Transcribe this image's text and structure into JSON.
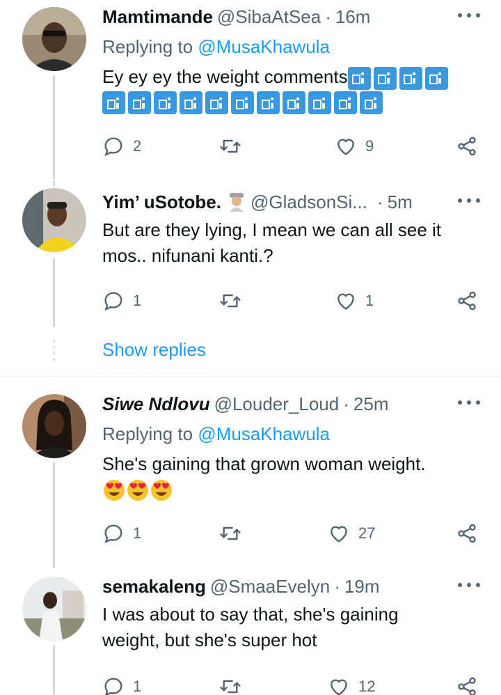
{
  "tweets": [
    {
      "name": "Mamtimande",
      "handle": "@SibaAtSea",
      "time": "16m",
      "replying_label": "Replying to",
      "replying_to": "@MusaKhawula",
      "text": "Ey ey ey the weight comments",
      "emoji_name": "wastebasket-emoji",
      "emoji_count_line1": 4,
      "emoji_count_line2": 11,
      "replies": "2",
      "retweets": "",
      "likes": "9"
    },
    {
      "name": "Yim’ uSotobe.",
      "handle": "@GladsonSi...",
      "time": "5m",
      "text": "But are they lying, I mean we can all see it mos.. nifunani kanti.?",
      "replies": "1",
      "retweets": "",
      "likes": "1"
    },
    {
      "name": "Siwe Ndlovu",
      "handle": "@Louder_Loud",
      "time": "25m",
      "replying_label": "Replying to",
      "replying_to": "@MusaKhawula",
      "text": "She's gaining that grown woman weight.",
      "emoji_name": "heart-eyes-emoji",
      "emoji_count": 3,
      "replies": "1",
      "retweets": "",
      "likes": "27"
    },
    {
      "name": "semakaleng",
      "handle": "@SmaaEvelyn",
      "time": "19m",
      "text": "I was about to say that, she's gaining weight, but she's super hot",
      "replies": "1",
      "retweets": "",
      "likes": "12"
    }
  ],
  "separator": "·",
  "show_replies_label": "Show replies",
  "colors": {
    "text": "#0f1419",
    "secondary": "#536471",
    "accent": "#1d9bf0",
    "thread_line": "#cfd9de"
  }
}
